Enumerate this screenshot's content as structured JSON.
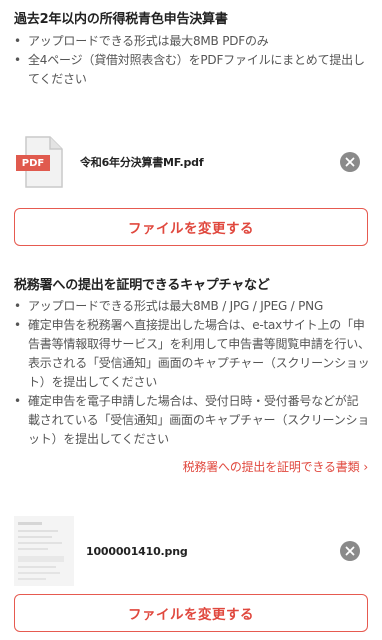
{
  "section1": {
    "title": "過去2年以内の所得税青色申告決算書",
    "bullets": [
      "アップロードできる形式は最大8MB PDFのみ",
      "全4ページ（貸借対照表含む）をPDFファイルにまとめて提出してください"
    ],
    "file": {
      "icon": "pdf-file-icon",
      "icon_label": "PDF",
      "name": "令和6年分決算書MF.pdf"
    },
    "change_button": "ファイルを変更する"
  },
  "section2": {
    "title": "税務署への提出を証明できるキャプチャなど",
    "bullets": [
      "アップロードできる形式は最大8MB / JPG / JPEG / PNG",
      "確定申告を税務署へ直接提出した場合は、e-taxサイト上の「申告書等情報取得サービス」を利用して申告書等閲覧申請を行い、表示される「受信通知」画面のキャプチャー（スクリーンショット）を提出してください",
      "確定申告を電子申請した場合は、受付日時・受付番号などが記載されている「受信通知」画面のキャプチャー（スクリーンショット）を提出してください"
    ],
    "link": "税務署への提出を証明できる書類",
    "file": {
      "icon": "image-thumbnail",
      "name": "1000001410.png"
    },
    "change_button": "ファイルを変更する"
  },
  "colors": {
    "accent": "#e0483e",
    "remove": "#8a8a8a",
    "pdf_badge": "#e05a4e"
  }
}
